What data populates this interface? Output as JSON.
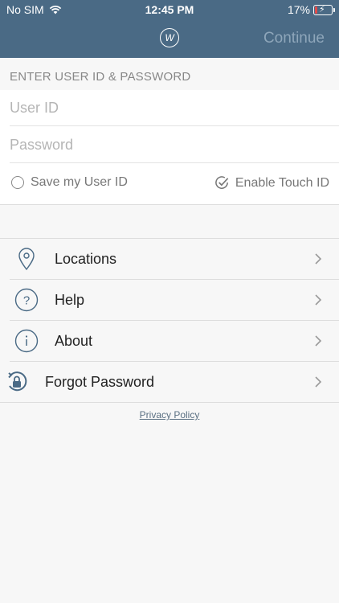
{
  "status_bar": {
    "carrier": "No SIM",
    "time": "12:45 PM",
    "battery": "17%",
    "battery_level": 0.17,
    "icons": [
      "wifi-icon",
      "battery-charging-icon"
    ]
  },
  "nav": {
    "logo_glyph": "W",
    "continue_label": "Continue"
  },
  "login": {
    "section_label": "ENTER USER ID & PASSWORD",
    "user_id_placeholder": "User ID",
    "password_placeholder": "Password",
    "save_user_id_label": "Save my User ID",
    "enable_touch_id_label": "Enable Touch ID"
  },
  "menu": {
    "items": [
      {
        "label": "Locations",
        "icon": "location-pin-icon"
      },
      {
        "label": "Help",
        "icon": "question-icon"
      },
      {
        "label": "About",
        "icon": "info-icon"
      },
      {
        "label": "Forgot Password",
        "icon": "lock-refresh-icon"
      }
    ]
  },
  "footer": {
    "privacy_label": "Privacy Policy"
  },
  "colors": {
    "header_bg": "#4a6a85",
    "continue_disabled": "#8ea6ba",
    "icon_stroke": "#4a6a85",
    "battery_low": "#e04a4a"
  }
}
